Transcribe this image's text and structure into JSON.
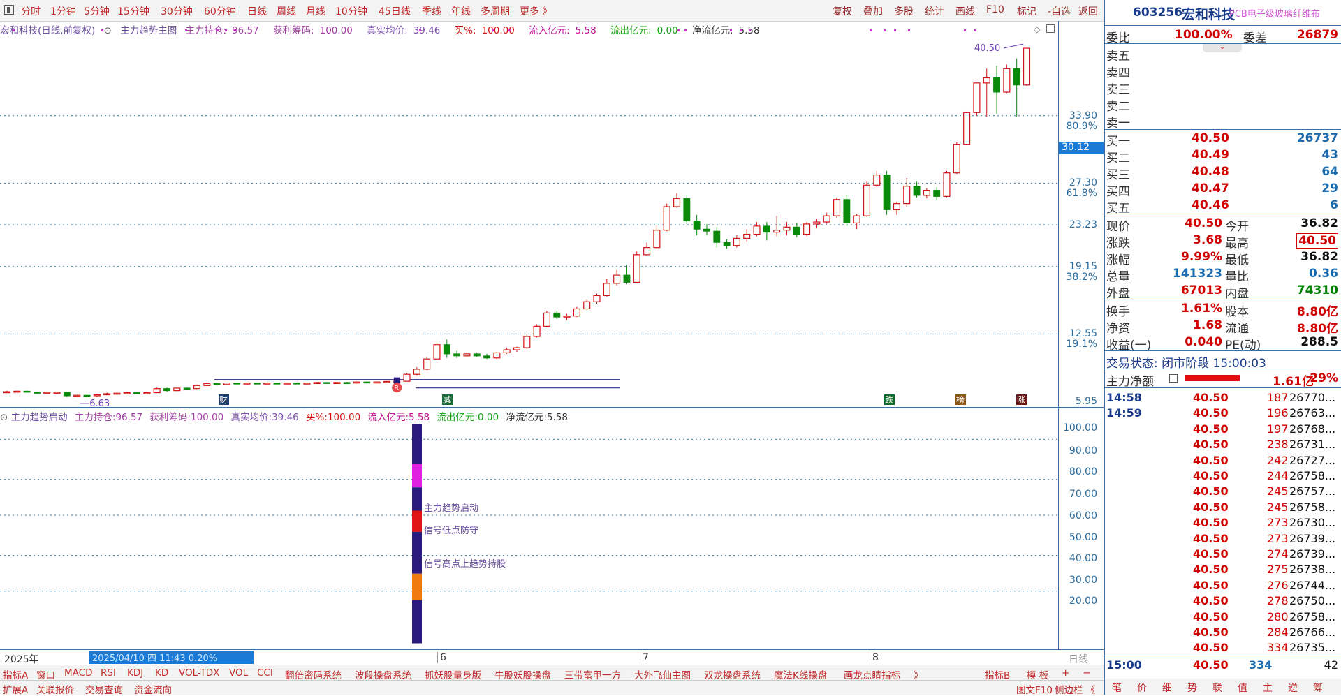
{
  "toolbar": {
    "periods": [
      "分时",
      "1分钟",
      "5分钟",
      "15分钟",
      "30分钟",
      "60分钟",
      "日线",
      "周线",
      "月线",
      "10分钟",
      "45日线",
      "季线",
      "年线",
      "多周期",
      "更多 》"
    ],
    "right_items": [
      "复权",
      "叠加",
      "多股",
      "统计",
      "画线",
      "F10",
      "标记",
      "-自选",
      "返回"
    ]
  },
  "infoline": {
    "stock": "宏和科技(日线,前复权)",
    "indicator": "主力趋势主图",
    "hold_label": "主力持仓:",
    "hold": "96.57",
    "profit_label": "获利筹码:",
    "profit": "100.00",
    "avg_label": "真实均价:",
    "avg": "39.46",
    "buy_label": "买%:",
    "buy": "100.00",
    "inflow_label": "流入亿元:",
    "inflow": "5.58",
    "outflow_label": "流出亿元:",
    "outflow": "0.00",
    "net_label": "净流亿元:",
    "net": "5.58"
  },
  "price_axis": {
    "labels": [
      "33.90",
      "27.30",
      "23.23",
      "19.15",
      "12.55",
      "5.95"
    ],
    "pct_labels": [
      "80.9%",
      "61.8%",
      "38.2%",
      "19.1%"
    ],
    "cursor_price": "30.12"
  },
  "chart_data": {
    "type": "candlestick",
    "high_label": "40.50",
    "low_label": "6.63",
    "ohlc": [
      [
        6.9,
        7.0,
        6.8,
        6.9
      ],
      [
        6.9,
        7.0,
        6.8,
        6.95
      ],
      [
        6.95,
        7.0,
        6.8,
        6.85
      ],
      [
        6.85,
        6.9,
        6.7,
        6.8
      ],
      [
        6.8,
        6.9,
        6.75,
        6.85
      ],
      [
        6.85,
        6.9,
        6.8,
        6.85
      ],
      [
        6.85,
        6.9,
        6.4,
        6.5
      ],
      [
        6.5,
        6.6,
        6.4,
        6.55
      ],
      [
        6.55,
        6.7,
        6.3,
        6.5
      ],
      [
        6.5,
        6.7,
        6.4,
        6.6
      ],
      [
        6.6,
        6.8,
        6.55,
        6.7
      ],
      [
        6.7,
        6.8,
        6.6,
        6.75
      ],
      [
        6.75,
        6.85,
        6.7,
        6.8
      ],
      [
        6.8,
        6.9,
        6.7,
        6.75
      ],
      [
        6.75,
        6.85,
        6.65,
        6.8
      ],
      [
        6.8,
        7.3,
        6.75,
        7.2
      ],
      [
        7.2,
        7.3,
        6.9,
        7.0
      ],
      [
        7.0,
        7.3,
        6.95,
        7.25
      ],
      [
        7.25,
        7.3,
        7.1,
        7.2
      ],
      [
        7.2,
        7.6,
        7.15,
        7.5
      ],
      [
        7.5,
        7.8,
        7.45,
        7.7
      ],
      [
        7.7,
        7.75,
        7.5,
        7.6
      ],
      [
        7.6,
        7.8,
        7.55,
        7.75
      ],
      [
        7.75,
        7.8,
        7.65,
        7.7
      ],
      [
        7.7,
        7.8,
        7.6,
        7.75
      ],
      [
        7.75,
        7.8,
        7.7,
        7.72
      ],
      [
        7.72,
        7.8,
        7.65,
        7.75
      ],
      [
        7.75,
        7.8,
        7.7,
        7.73
      ],
      [
        7.73,
        7.8,
        7.68,
        7.75
      ],
      [
        7.75,
        7.8,
        7.7,
        7.72
      ],
      [
        7.72,
        7.8,
        7.65,
        7.75
      ],
      [
        7.75,
        7.85,
        7.7,
        7.8
      ],
      [
        7.8,
        7.85,
        7.7,
        7.75
      ],
      [
        7.75,
        7.85,
        7.7,
        7.8
      ],
      [
        7.8,
        7.85,
        7.7,
        7.75
      ],
      [
        7.75,
        7.9,
        7.7,
        7.85
      ],
      [
        7.85,
        7.9,
        7.75,
        7.8
      ],
      [
        7.8,
        7.9,
        7.75,
        7.85
      ],
      [
        7.85,
        7.95,
        7.8,
        7.9
      ],
      [
        7.9,
        7.95,
        7.85,
        7.92
      ],
      [
        7.92,
        8.7,
        7.9,
        8.6
      ],
      [
        8.6,
        9.3,
        8.5,
        9.1
      ],
      [
        9.1,
        10.3,
        9.0,
        10.1
      ],
      [
        10.1,
        11.9,
        10.0,
        11.5
      ],
      [
        11.5,
        12.0,
        10.2,
        10.6
      ],
      [
        10.6,
        10.9,
        10.2,
        10.4
      ],
      [
        10.4,
        10.8,
        10.3,
        10.6
      ],
      [
        10.6,
        10.7,
        10.3,
        10.4
      ],
      [
        10.4,
        10.6,
        10.1,
        10.2
      ],
      [
        10.2,
        10.8,
        10.1,
        10.7
      ],
      [
        10.7,
        11.2,
        10.6,
        11.0
      ],
      [
        11.0,
        11.3,
        10.8,
        11.2
      ],
      [
        11.2,
        12.5,
        11.1,
        12.3
      ],
      [
        12.3,
        13.5,
        12.2,
        13.3
      ],
      [
        13.3,
        14.8,
        13.2,
        14.6
      ],
      [
        14.6,
        14.8,
        14.0,
        14.2
      ],
      [
        14.2,
        14.5,
        13.9,
        14.3
      ],
      [
        14.3,
        15.2,
        14.2,
        15.0
      ],
      [
        15.0,
        15.9,
        14.9,
        15.7
      ],
      [
        15.7,
        16.5,
        15.5,
        16.3
      ],
      [
        16.3,
        17.9,
        16.2,
        17.5
      ],
      [
        17.5,
        18.8,
        17.3,
        18.3
      ],
      [
        18.3,
        19.3,
        17.4,
        17.6
      ],
      [
        17.6,
        20.6,
        17.5,
        20.3
      ],
      [
        20.3,
        21.5,
        20.2,
        21.0
      ],
      [
        21.0,
        23.2,
        20.9,
        22.7
      ],
      [
        22.7,
        25.3,
        22.6,
        25.0
      ],
      [
        25.0,
        26.3,
        24.9,
        25.8
      ],
      [
        25.8,
        26.1,
        23.3,
        23.6
      ],
      [
        23.6,
        24.2,
        22.2,
        22.8
      ],
      [
        22.8,
        23.3,
        22.2,
        22.6
      ],
      [
        22.6,
        23.0,
        21.0,
        21.5
      ],
      [
        21.5,
        21.8,
        20.9,
        21.2
      ],
      [
        21.2,
        22.2,
        21.0,
        21.9
      ],
      [
        21.9,
        22.8,
        21.6,
        22.3
      ],
      [
        22.3,
        23.5,
        22.1,
        23.1
      ],
      [
        23.1,
        23.5,
        21.7,
        22.5
      ],
      [
        22.5,
        24.1,
        22.1,
        22.7
      ],
      [
        22.7,
        23.5,
        22.2,
        23.0
      ],
      [
        23.0,
        23.4,
        22.0,
        22.3
      ],
      [
        22.3,
        23.5,
        22.1,
        23.3
      ],
      [
        23.3,
        23.8,
        22.9,
        23.5
      ],
      [
        23.5,
        24.4,
        23.3,
        24.1
      ],
      [
        24.1,
        25.9,
        23.9,
        25.7
      ],
      [
        25.7,
        26.1,
        23.1,
        23.4
      ],
      [
        23.4,
        24.3,
        22.8,
        24.1
      ],
      [
        24.1,
        27.5,
        24.0,
        27.1
      ],
      [
        27.1,
        28.5,
        26.9,
        28.1
      ],
      [
        28.1,
        28.5,
        24.2,
        24.7
      ],
      [
        24.7,
        25.5,
        24.2,
        25.3
      ],
      [
        25.3,
        27.8,
        25.0,
        27.0
      ],
      [
        27.0,
        27.5,
        25.9,
        26.1
      ],
      [
        26.1,
        26.8,
        25.8,
        26.6
      ],
      [
        26.6,
        26.9,
        25.6,
        26.0
      ],
      [
        26.0,
        28.5,
        25.9,
        28.3
      ],
      [
        28.3,
        31.3,
        28.2,
        31.1
      ],
      [
        31.1,
        34.3,
        31.0,
        34.2
      ],
      [
        34.2,
        37.1,
        33.9,
        37.1
      ],
      [
        37.1,
        38.5,
        33.8,
        37.6
      ],
      [
        37.6,
        38.8,
        34.1,
        36.2
      ],
      [
        36.2,
        38.9,
        36.1,
        38.5
      ],
      [
        38.5,
        39.5,
        33.8,
        36.9
      ],
      [
        36.9,
        40.5,
        36.82,
        40.5
      ]
    ],
    "min": 5.95,
    "max": 41.8
  },
  "markers": {
    "cai": "财",
    "jian": "减",
    "die": "跌",
    "bang": "榜",
    "zhang": "涨",
    "r": "R"
  },
  "lower_panel": {
    "title": "主力趋势启动",
    "hold_label": "主力持仓:",
    "hold": "96.57",
    "profit_label": "获利筹码:",
    "profit": "100.00",
    "avg_label": "真实均价:",
    "avg": "39.46",
    "buy_label": "买%:",
    "buy": "100.00",
    "inflow_label": "流入亿元:",
    "inflow": "5.58",
    "outflow_label": "流出亿元:",
    "outflow": "0.00",
    "net_label": "净流亿元:",
    "net": "5.58",
    "axis": [
      "100.00",
      "90.00",
      "80.00",
      "70.00",
      "60.00",
      "50.00",
      "40.00",
      "30.00",
      "20.00"
    ],
    "labels": [
      "主力趋势启动",
      "信号低点防守",
      "信号高点上趋势持股"
    ]
  },
  "date_axis": {
    "year": "2025年",
    "cursor": "2025/04/10 四  11:43  0.20%",
    "months": [
      "6",
      "7",
      "8"
    ],
    "right": "日线"
  },
  "indicator_tabs": [
    "指标A",
    "窗口",
    "MACD",
    "RSI",
    "KDJ",
    "KD",
    "VOL-TDX",
    "VOL",
    "CCI",
    "翻倍密码系统",
    "波段操盘系统",
    "抓妖股量身版",
    "牛股妖股操盘",
    "三带富甲一方",
    "大外飞仙主图",
    "双龙操盘系统",
    "魔法K线操盘",
    "画龙点睛指标",
    "》",
    "指标B",
    "模 板",
    "+",
    "−"
  ],
  "bottom_tabs": [
    "扩展A",
    "关联报价",
    "交易查询",
    "资金流向",
    "图文F10",
    "侧边栏 《"
  ],
  "quote": {
    "code": "603256",
    "name": "宏和科技",
    "sector": "PCB电子级玻璃纤维布",
    "webi_label": "委比",
    "webi": "100.00%",
    "wecha_label": "委差",
    "wecha": "26879",
    "sells": [
      "卖五",
      "卖四",
      "卖三",
      "卖二",
      "卖一"
    ],
    "buys": [
      {
        "label": "买一",
        "price": "40.50",
        "vol": "26737"
      },
      {
        "label": "买二",
        "price": "40.49",
        "vol": "43"
      },
      {
        "label": "买三",
        "price": "40.48",
        "vol": "64"
      },
      {
        "label": "买四",
        "price": "40.47",
        "vol": "29"
      },
      {
        "label": "买五",
        "price": "40.46",
        "vol": "6"
      }
    ],
    "stats": [
      {
        "l1": "现价",
        "v1": "40.50",
        "c1": "red",
        "l2": "今开",
        "v2": "36.82",
        "c2": "blk"
      },
      {
        "l1": "涨跌",
        "v1": "3.68",
        "c1": "red",
        "l2": "最高",
        "v2": "40.50",
        "c2": "red"
      },
      {
        "l1": "涨幅",
        "v1": "9.99%",
        "c1": "red",
        "l2": "最低",
        "v2": "36.82",
        "c2": "blk"
      },
      {
        "l1": "总量",
        "v1": "141323",
        "c1": "blu",
        "l2": "量比",
        "v2": "0.36",
        "c2": "blu"
      },
      {
        "l1": "外盘",
        "v1": "67013",
        "c1": "red",
        "l2": "内盘",
        "v2": "74310",
        "c2": "grn"
      },
      {
        "l1": "换手",
        "v1": "1.61%",
        "c1": "red",
        "l2": "股本",
        "v2": "8.80亿",
        "c2": "red"
      },
      {
        "l1": "净资",
        "v1": "1.68",
        "c1": "red",
        "l2": "流通",
        "v2": "8.80亿",
        "c2": "red"
      },
      {
        "l1": "收益(一)",
        "v1": "0.040",
        "c1": "red",
        "l2": "PE(动)",
        "v2": "288.5",
        "c2": "blk"
      }
    ],
    "trade_state": "交易状态: 闭市阶段 15:00:03",
    "main_net_label": "主力净额",
    "main_net": "1.61亿",
    "main_net_pct": "29%",
    "main_net_fill": 0.75,
    "ticks": [
      {
        "t": "14:58",
        "p": "40.50",
        "v": "187",
        "x": "26770..."
      },
      {
        "t": "14:59",
        "p": "40.50",
        "v": "196",
        "x": "26763..."
      },
      {
        "t": "",
        "p": "40.50",
        "v": "197",
        "x": "26768..."
      },
      {
        "t": "",
        "p": "40.50",
        "v": "238",
        "x": "26731..."
      },
      {
        "t": "",
        "p": "40.50",
        "v": "242",
        "x": "26727..."
      },
      {
        "t": "",
        "p": "40.50",
        "v": "244",
        "x": "26758..."
      },
      {
        "t": "",
        "p": "40.50",
        "v": "245",
        "x": "26757..."
      },
      {
        "t": "",
        "p": "40.50",
        "v": "245",
        "x": "26758..."
      },
      {
        "t": "",
        "p": "40.50",
        "v": "273",
        "x": "26730..."
      },
      {
        "t": "",
        "p": "40.50",
        "v": "273",
        "x": "26739..."
      },
      {
        "t": "",
        "p": "40.50",
        "v": "274",
        "x": "26739..."
      },
      {
        "t": "",
        "p": "40.50",
        "v": "275",
        "x": "26738..."
      },
      {
        "t": "",
        "p": "40.50",
        "v": "276",
        "x": "26744..."
      },
      {
        "t": "",
        "p": "40.50",
        "v": "278",
        "x": "26750..."
      },
      {
        "t": "",
        "p": "40.50",
        "v": "280",
        "x": "26758..."
      },
      {
        "t": "",
        "p": "40.50",
        "v": "284",
        "x": "26766..."
      },
      {
        "t": "",
        "p": "40.50",
        "v": "334",
        "x": "26735..."
      }
    ],
    "last": {
      "t": "15:00",
      "p": "40.50",
      "v": "334",
      "x": "42"
    },
    "foot": [
      "笔",
      "价",
      "细",
      "势",
      "联",
      "值",
      "主",
      "逆",
      "筹"
    ]
  }
}
